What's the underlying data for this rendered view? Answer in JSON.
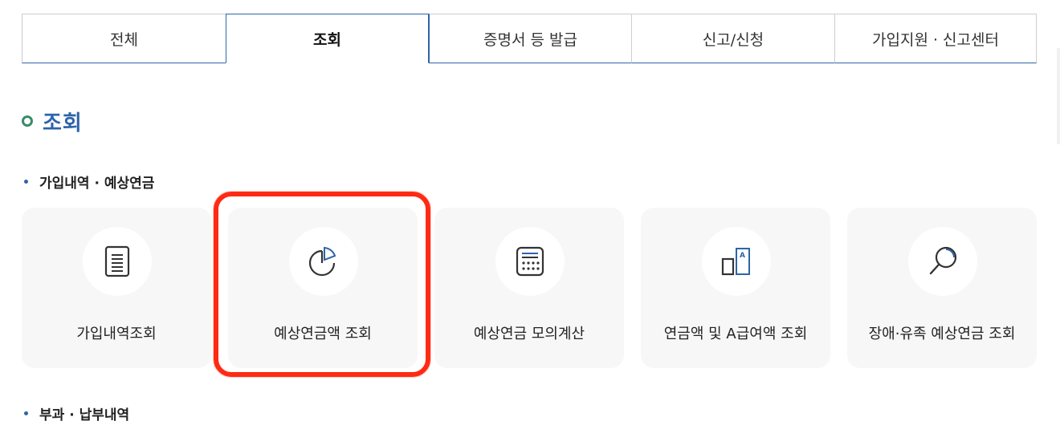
{
  "tabs": [
    {
      "label": "전체"
    },
    {
      "label": "조회"
    },
    {
      "label": "증명서 등 발급"
    },
    {
      "label": "신고/신청"
    },
    {
      "label": "가입지원 · 신고센터"
    }
  ],
  "active_tab": "조회",
  "section": {
    "title": "조회"
  },
  "groups": [
    {
      "heading": "가입내역 · 예상연금"
    },
    {
      "heading": "부과 · 납부내역"
    }
  ],
  "cards": [
    {
      "label": "가입내역조회",
      "icon": "document-icon"
    },
    {
      "label": "예상연금액 조회",
      "icon": "pie-chart-icon"
    },
    {
      "label": "예상연금 모의계산",
      "icon": "calculator-icon"
    },
    {
      "label": "연금액 및 A급여액 조회",
      "icon": "compare-a-icon"
    },
    {
      "label": "장애·유족 예상연금 조회",
      "icon": "magnifier-icon"
    }
  ],
  "colors": {
    "accent": "#2e64a8",
    "highlight": "#ff2a14",
    "ring": "#3b8a6a"
  }
}
